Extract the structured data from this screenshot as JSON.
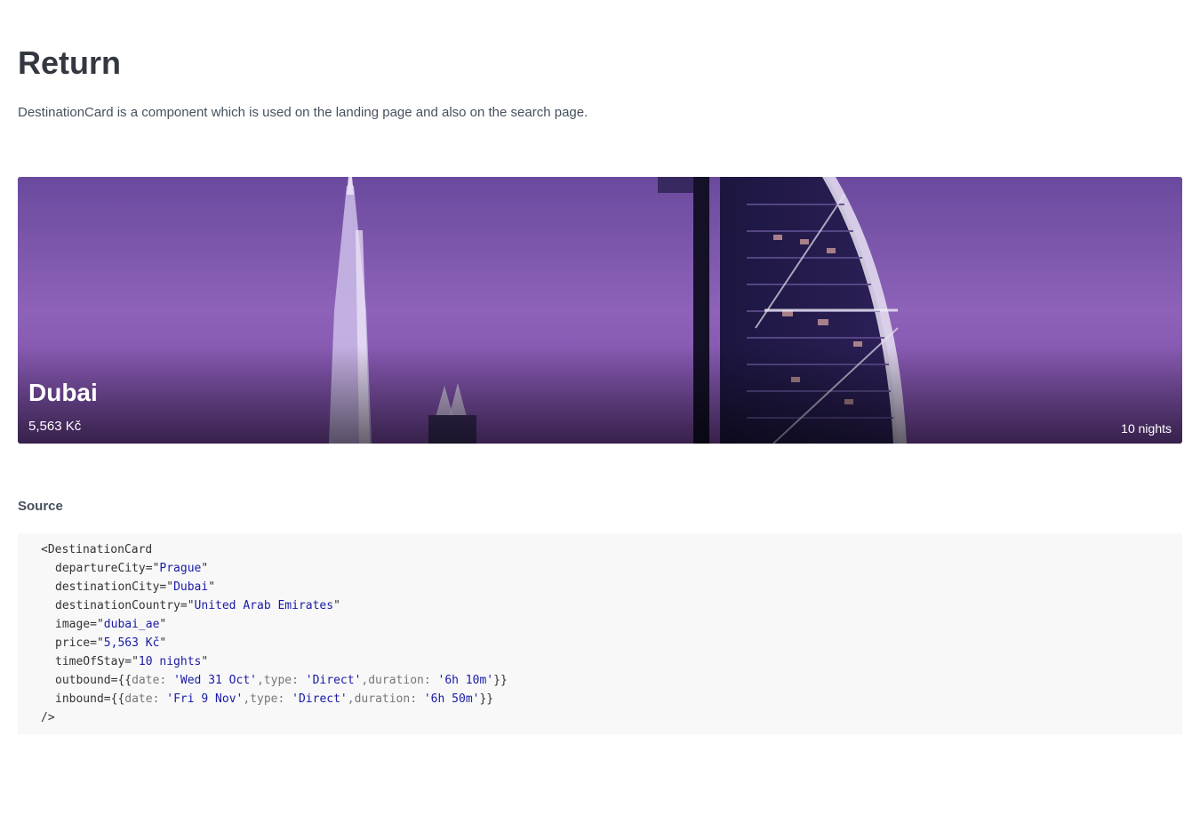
{
  "page": {
    "title": "Return",
    "description": "DestinationCard is a component which is used on the landing page and also on the search page."
  },
  "card": {
    "city": "Dubai",
    "price": "5,563 Kč",
    "nights": "10 nights"
  },
  "source": {
    "heading": "Source",
    "component_open": "<DestinationCard",
    "component_close": "/>",
    "props": [
      {
        "name": "departureCity=",
        "value": "Prague"
      },
      {
        "name": "destinationCity=",
        "value": "Dubai"
      },
      {
        "name": "destinationCountry=",
        "value": "United Arab Emirates"
      },
      {
        "name": "image=",
        "value": "dubai_ae"
      },
      {
        "name": "price=",
        "value": "5,563 Kč"
      },
      {
        "name": "timeOfStay=",
        "value": "10 nights"
      }
    ],
    "outbound": {
      "prefix": "outbound={{",
      "date_key": "date: ",
      "date": "'Wed 31 Oct'",
      "type_key": ",type: ",
      "type": "'Direct'",
      "duration_key": ",duration: ",
      "duration": "'6h 10m'",
      "suffix": "}}"
    },
    "inbound": {
      "prefix": "inbound={{",
      "date_key": "date: ",
      "date": "'Fri 9 Nov'",
      "type_key": ",type: ",
      "type": "'Direct'",
      "duration_key": ",duration: ",
      "duration": "'6h 50m'",
      "suffix": "}}"
    },
    "quote": "\""
  },
  "colors": {
    "title": "#333840",
    "text": "#46515e",
    "code_string": "#1a1aa6",
    "code_background": "#f8f8f8",
    "card_sky": "#8a5cb6"
  }
}
